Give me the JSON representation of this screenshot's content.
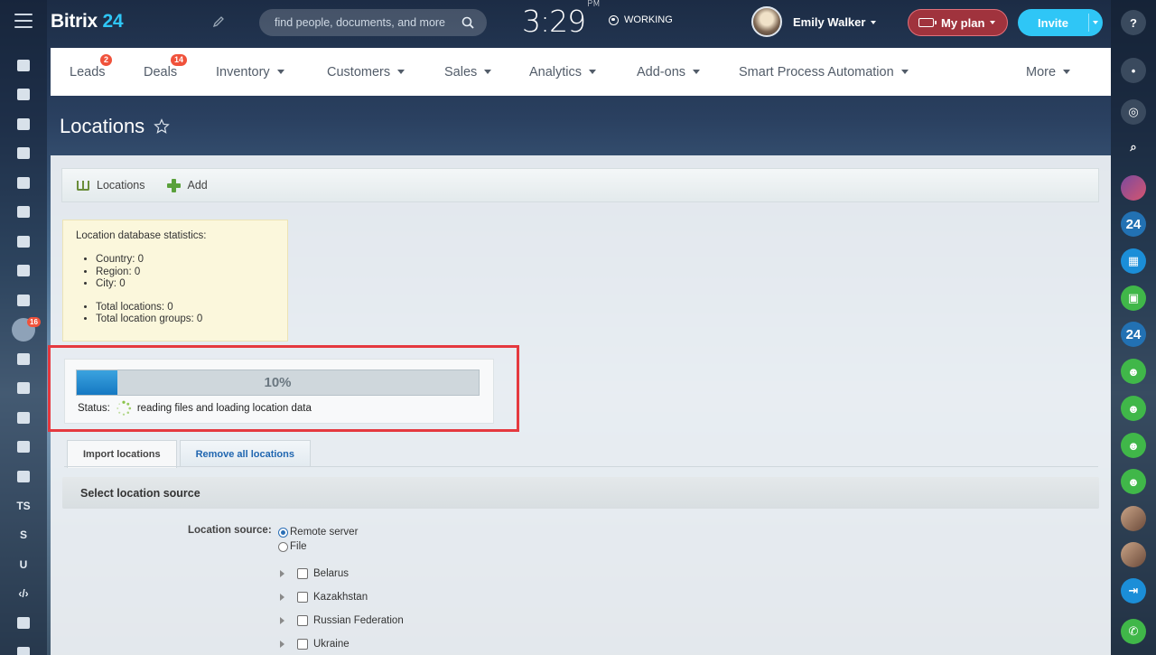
{
  "header": {
    "logo_main": "Bitrix",
    "logo_num": "24",
    "search_placeholder": "find people, documents, and more",
    "clock_time": "3:29",
    "clock_ampm": "PM",
    "work_status": "WORKING",
    "user_name": "Emily Walker",
    "plan_label": "My plan",
    "invite_label": "Invite"
  },
  "left_rail": {
    "badge_count": "16",
    "text_items": [
      "TS",
      "S",
      "U"
    ]
  },
  "nav": {
    "items": [
      {
        "label": "Leads",
        "badge": "2"
      },
      {
        "label": "Deals",
        "badge": "14"
      },
      {
        "label": "Inventory"
      },
      {
        "label": "Customers"
      },
      {
        "label": "Sales"
      },
      {
        "label": "Analytics"
      },
      {
        "label": "Add-ons"
      },
      {
        "label": "Smart Process Automation"
      },
      {
        "label": "More"
      }
    ]
  },
  "right_rail": {
    "items": [
      "24",
      "24"
    ]
  },
  "page": {
    "title": "Locations"
  },
  "toolbar": {
    "locations_label": "Locations",
    "add_label": "Add"
  },
  "stats": {
    "heading": "Location database statistics:",
    "group1": [
      "Country: 0",
      "Region: 0",
      "City: 0"
    ],
    "group2": [
      "Total locations: 0",
      "Total location groups: 0"
    ]
  },
  "progress": {
    "percent": 10,
    "percent_label": "10%",
    "status_label": "Status:",
    "status_text": "reading files and loading location data"
  },
  "tabs": {
    "import": "Import locations",
    "remove": "Remove all locations"
  },
  "section": {
    "heading": "Select location source",
    "source_label": "Location source:",
    "options": [
      "Remote server",
      "File"
    ],
    "selected": "Remote server",
    "countries": [
      "Belarus",
      "Kazakhstan",
      "Russian Federation",
      "Ukraine"
    ]
  },
  "colors": {
    "accent": "#2fc6f6",
    "plan": "#a0333d",
    "badge": "#f0523b",
    "highlight": "#e5393f",
    "progress": "#1b86cf"
  }
}
